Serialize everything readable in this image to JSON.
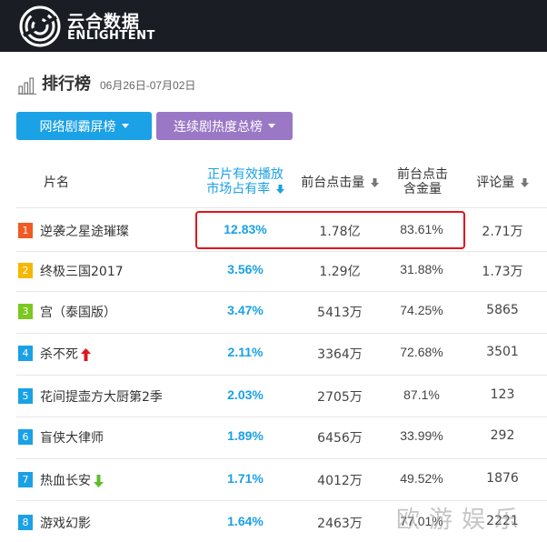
{
  "brand": {
    "name_cn": "云合数据",
    "name_en": "ENLIGHTENT"
  },
  "page": {
    "title": "排行榜",
    "date_range": "06月26日-07月02日"
  },
  "filters": {
    "primary_label": "网络剧霸屏榜",
    "secondary_label": "连续剧热度总榜"
  },
  "table": {
    "headers": {
      "name": "片名",
      "share_line1": "正片有效播放",
      "share_line2": "市场占有率",
      "clicks": "前台点击量",
      "gold_line1": "前台点击",
      "gold_line2": "含金量",
      "reviews": "评论量"
    },
    "rows": [
      {
        "rank": "1",
        "name": "逆袭之星途璀璨",
        "share": "12.83%",
        "clicks": "1.78亿",
        "gold": "83.61%",
        "reviews": "2.71万",
        "trend": ""
      },
      {
        "rank": "2",
        "name": "终极三国2017",
        "share": "3.56%",
        "clicks": "1.29亿",
        "gold": "31.88%",
        "reviews": "1.73万",
        "trend": ""
      },
      {
        "rank": "3",
        "name": "宫（泰国版）",
        "share": "3.47%",
        "clicks": "5413万",
        "gold": "74.25%",
        "reviews": "5865",
        "trend": ""
      },
      {
        "rank": "4",
        "name": "杀不死",
        "share": "2.11%",
        "clicks": "3364万",
        "gold": "72.68%",
        "reviews": "3501",
        "trend": "up"
      },
      {
        "rank": "5",
        "name": "花间提壶方大厨第2季",
        "share": "2.03%",
        "clicks": "2705万",
        "gold": "87.1%",
        "reviews": "123",
        "trend": ""
      },
      {
        "rank": "6",
        "name": "盲侠大律师",
        "share": "1.89%",
        "clicks": "6456万",
        "gold": "33.99%",
        "reviews": "292",
        "trend": ""
      },
      {
        "rank": "7",
        "name": "热血长安",
        "share": "1.71%",
        "clicks": "4012万",
        "gold": "49.52%",
        "reviews": "1876",
        "trend": "down"
      },
      {
        "rank": "8",
        "name": "游戏幻影",
        "share": "1.64%",
        "clicks": "2463万",
        "gold": "77.01%",
        "reviews": "2221",
        "trend": ""
      }
    ]
  },
  "watermark": "欧游娱乐",
  "colors": {
    "header_bg": "#1a1d23",
    "accent_blue": "#1aa1e6",
    "accent_purple": "#9b78c6",
    "rank1": "#f15a22",
    "rank2": "#f5b800",
    "rank3": "#7ac820",
    "highlight": "#e1141e",
    "trend_up": "#e1141e",
    "trend_down": "#5cbf2a"
  },
  "icons": [
    "enlightent-logo-icon",
    "bar-chart-icon",
    "chevron-down-icon",
    "sort-desc-icon",
    "arrow-up-icon",
    "arrow-down-icon"
  ]
}
